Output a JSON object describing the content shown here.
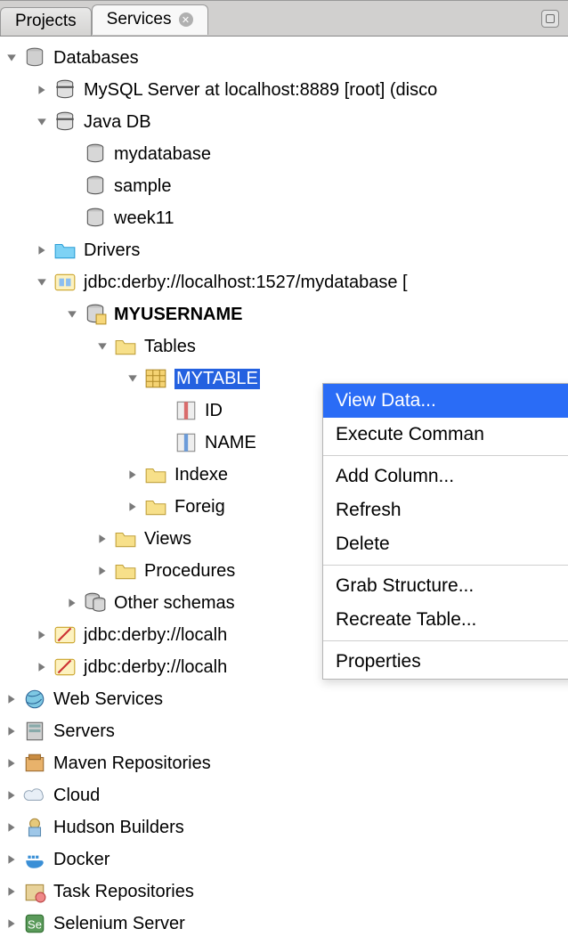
{
  "tabs": {
    "projects": "Projects",
    "services": "Services"
  },
  "tree": {
    "databases": "Databases",
    "mysql_server": "MySQL Server at localhost:8889 [root] (disco",
    "javadb": "Java DB",
    "mydatabase": "mydatabase",
    "sample": "sample",
    "week11": "week11",
    "drivers": "Drivers",
    "jdbc_mydb": "jdbc:derby://localhost:1527/mydatabase [",
    "myusername": "MYUSERNAME",
    "tables": "Tables",
    "mytable": "MYTABLE",
    "col_id": "ID",
    "col_name": "NAME",
    "indexes": "Indexe",
    "fkeys": "Foreig",
    "views": "Views",
    "procedures": "Procedures",
    "other_schemas": "Other schemas",
    "jdbc2": "jdbc:derby://localh",
    "jdbc3": "jdbc:derby://localh",
    "web_services": "Web Services",
    "servers": "Servers",
    "maven": "Maven Repositories",
    "cloud": "Cloud",
    "hudson": "Hudson Builders",
    "docker": "Docker",
    "task_repos": "Task Repositories",
    "selenium": "Selenium Server"
  },
  "menu": {
    "view_data": "View Data...",
    "exec_command": "Execute Comman",
    "add_column": "Add Column...",
    "refresh": "Refresh",
    "delete": "Delete",
    "grab_structure": "Grab Structure...",
    "recreate_table": "Recreate Table...",
    "properties": "Properties"
  }
}
